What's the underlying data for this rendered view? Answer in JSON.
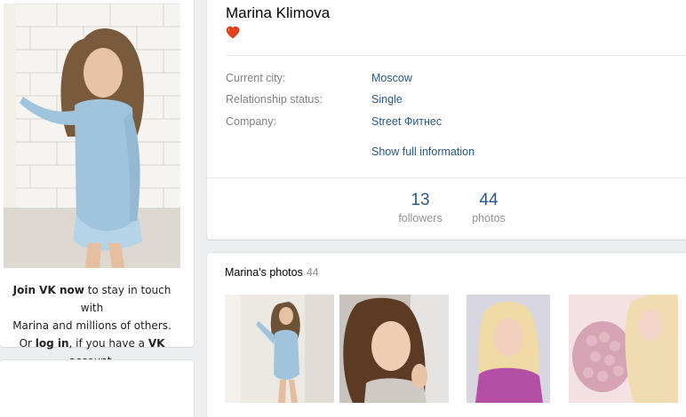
{
  "profile": {
    "name": "Marina Klimova",
    "info": [
      {
        "label": "Current city:",
        "value": "Moscow"
      },
      {
        "label": "Relationship status:",
        "value": "Single"
      },
      {
        "label": "Company:",
        "value": "Street Фитнес"
      }
    ],
    "show_full": "Show full information",
    "counters": [
      {
        "num": "13",
        "label": "followers"
      },
      {
        "num": "44",
        "label": "photos"
      }
    ]
  },
  "join": {
    "join_link": "Join VK now",
    "line1_rest": " to stay in touch with",
    "line2": "Marina and millions of others.",
    "line3_pre": "Or ",
    "login_link": "log in",
    "line3_mid": ", if you have a ",
    "vk": "VK",
    "line3_end": " account."
  },
  "photos": {
    "title": "Marina's photos",
    "count": "44"
  },
  "colors": {
    "link": "#2a5885",
    "label": "#828282",
    "background": "#edeef0"
  }
}
